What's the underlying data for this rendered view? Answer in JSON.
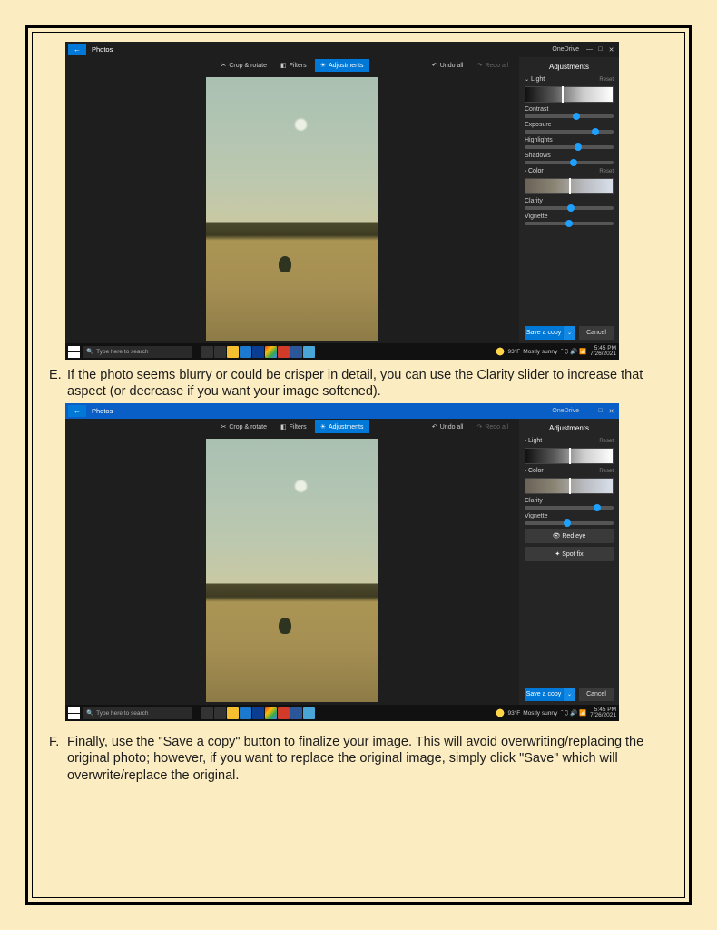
{
  "page": {
    "bullet_E": "E.",
    "text_E": "If the photo seems blurry or could be crisper in detail, you can use the Clarity slider to increase that aspect (or decrease if you want your image softened).",
    "bullet_F": "F.",
    "text_F": "Finally, use the \"Save a copy\" button to finalize your image. This will avoid overwriting/replacing the original photo; however, if you want to replace the original image, simply click \"Save\" which will overwrite/replace the original."
  },
  "app": {
    "back": "←",
    "title": "Photos",
    "onedrive": "OneDrive",
    "min": "—",
    "max": "□",
    "close": "✕",
    "tools": {
      "crop": "Crop & rotate",
      "filters": "Filters",
      "adjust": "Adjustments"
    },
    "undo": "Undo all",
    "redo": "Redo all",
    "side": {
      "title": "Adjustments",
      "light": "Light",
      "color": "Color",
      "reset": "Reset",
      "contrast": "Contrast",
      "exposure": "Exposure",
      "highlights": "Highlights",
      "shadows": "Shadows",
      "clarity": "Clarity",
      "vignette": "Vignette",
      "redeye": "Red eye",
      "spotfix": "Spot fix"
    },
    "actions": {
      "save": "Save a copy",
      "cancel": "Cancel"
    }
  },
  "taskbar": {
    "search": "Type here to search",
    "weather_temp": "93°F",
    "weather_text": "Mostly sunny",
    "time": "5:45 PM",
    "date": "7/26/2021"
  },
  "sliders": {
    "s1": {
      "light_marker": 42,
      "contrast": 58,
      "exposure": 80,
      "highlights": 60,
      "shadows": 55,
      "color_marker": 50,
      "clarity": 52,
      "vignette": 50
    },
    "s2": {
      "light_marker": 50,
      "color_marker": 50,
      "clarity": 82,
      "vignette": 48
    }
  }
}
